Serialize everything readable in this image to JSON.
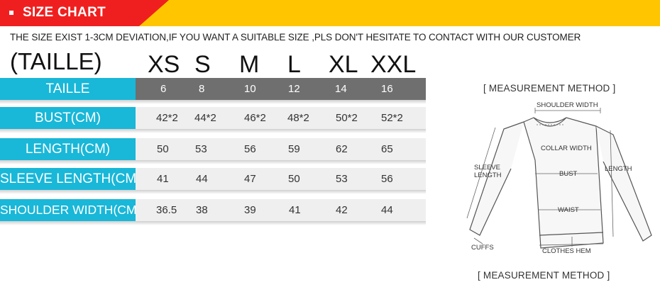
{
  "banner": {
    "title": "SIZE CHART",
    "accent": "#f01f1f",
    "band": "#ffc600"
  },
  "notice": "THE SIZE EXIST 1-3CM DEVIATION,IF YOU WANT A SUITABLE SIZE ,PLS DON'T HESITATE TO CONTACT WITH OUR CUSTOMER",
  "table": {
    "header_label": "(TAILLE)",
    "sizes": [
      "XS",
      "S",
      "M",
      "L",
      "XL",
      "XXL"
    ],
    "rows": [
      {
        "label": "TAILLE",
        "values": [
          "6",
          "8",
          "10",
          "12",
          "14",
          "16"
        ]
      },
      {
        "label": "BUST(CM)",
        "values": [
          "42*2",
          "44*2",
          "46*2",
          "48*2",
          "50*2",
          "52*2"
        ]
      },
      {
        "label": "LENGTH(CM)",
        "values": [
          "50",
          "53",
          "56",
          "59",
          "62",
          "65"
        ]
      },
      {
        "label": "SLEEVE LENGTH(CM)",
        "values": [
          "41",
          "44",
          "47",
          "50",
          "53",
          "56"
        ]
      },
      {
        "label": "SHOULDER WIDTH(CM)",
        "values": [
          "36.5",
          "38",
          "39",
          "41",
          "42",
          "44"
        ]
      }
    ],
    "label_color": "#19b7d8"
  },
  "measurement": {
    "title_top": "[ MEASUREMENT METHOD ]",
    "title_bottom": "[ MEASUREMENT METHOD ]",
    "labels": {
      "shoulder_width": "SHOULDER WIDTH",
      "collar_width": "COLLAR WIDTH",
      "sleeve_length_1": "SLEEVE",
      "sleeve_length_2": "LENGTH",
      "bust": "BUST",
      "length": "LENGTH",
      "waist": "WAIST",
      "cuffs": "CUFFS",
      "clothes_hem": "CLOTHES HEM"
    }
  }
}
